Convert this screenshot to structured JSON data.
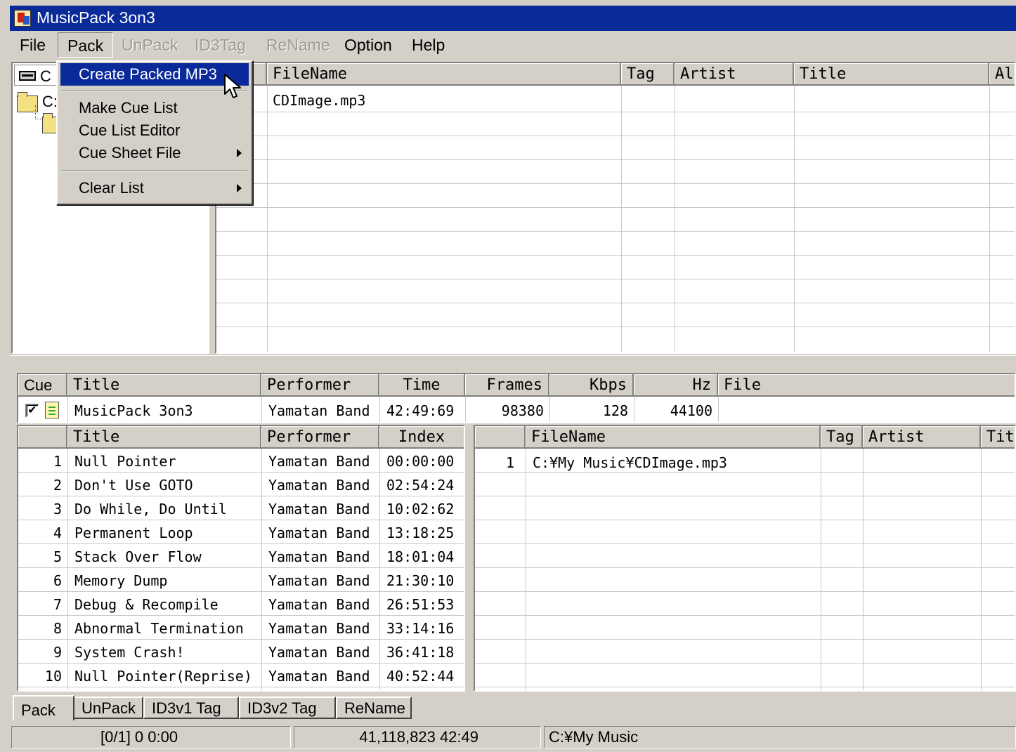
{
  "window": {
    "title": "MusicPack 3on3"
  },
  "menubar": [
    {
      "label": "File",
      "enabled": true
    },
    {
      "label": "Pack",
      "enabled": true
    },
    {
      "label": "UnPack",
      "enabled": false
    },
    {
      "label": "ID3Tag",
      "enabled": false
    },
    {
      "label": "ReName",
      "enabled": false
    },
    {
      "label": "Option",
      "enabled": true
    },
    {
      "label": "Help",
      "enabled": true
    }
  ],
  "pack_menu": {
    "items": [
      {
        "label": "Create Packed MP3",
        "selected": true
      },
      {
        "label": "Make Cue List"
      },
      {
        "label": "Cue List Editor"
      },
      {
        "label": "Cue Sheet File",
        "submenu": true
      },
      {
        "label": "Clear List",
        "submenu": true
      }
    ]
  },
  "tree": {
    "drive": "C",
    "root": "C:"
  },
  "file_list": {
    "headers": [
      "FileName",
      "Tag",
      "Artist",
      "Title",
      "Alb"
    ],
    "rows": [
      {
        "filename": "CDImage.mp3"
      }
    ]
  },
  "cue_summary": {
    "headers": [
      "Cue",
      "Title",
      "Performer",
      "Time",
      "Frames",
      "Kbps",
      "Hz",
      "File"
    ],
    "row": {
      "checked": true,
      "title": "MusicPack 3on3",
      "performer": "Yamatan Band",
      "time": "42:49:69",
      "frames": "98380",
      "kbps": "128",
      "hz": "44100",
      "file": ""
    }
  },
  "tracks": {
    "headers": [
      "",
      "Title",
      "Performer",
      "Index"
    ],
    "rows": [
      {
        "no": "1",
        "title": "Null Pointer",
        "performer": "Yamatan Band",
        "index": "00:00:00"
      },
      {
        "no": "2",
        "title": "Don't Use GOTO",
        "performer": "Yamatan Band",
        "index": "02:54:24"
      },
      {
        "no": "3",
        "title": "Do While, Do Until",
        "performer": "Yamatan Band",
        "index": "10:02:62"
      },
      {
        "no": "4",
        "title": "Permanent Loop",
        "performer": "Yamatan Band",
        "index": "13:18:25"
      },
      {
        "no": "5",
        "title": "Stack Over Flow",
        "performer": "Yamatan Band",
        "index": "18:01:04"
      },
      {
        "no": "6",
        "title": "Memory Dump",
        "performer": "Yamatan Band",
        "index": "21:30:10"
      },
      {
        "no": "7",
        "title": "Debug & Recompile",
        "performer": "Yamatan Band",
        "index": "26:51:53"
      },
      {
        "no": "8",
        "title": "Abnormal Termination",
        "performer": "Yamatan Band",
        "index": "33:14:16"
      },
      {
        "no": "9",
        "title": "System Crash!",
        "performer": "Yamatan Band",
        "index": "36:41:18"
      },
      {
        "no": "10",
        "title": "Null Pointer(Reprise)",
        "performer": "Yamatan Band",
        "index": "40:52:44"
      }
    ]
  },
  "source_files": {
    "headers": [
      "",
      "FileName",
      "Tag",
      "Artist",
      "Tit"
    ],
    "rows": [
      {
        "no": "1",
        "filename": "C:¥My Music¥CDImage.mp3"
      }
    ]
  },
  "tabs": [
    {
      "label": "Pack",
      "active": true
    },
    {
      "label": "UnPack"
    },
    {
      "label": "ID3v1 Tag"
    },
    {
      "label": "ID3v2 Tag"
    },
    {
      "label": "ReName"
    }
  ],
  "status": {
    "count": "[0/1]  0  0:00",
    "size": "41,118,823  42:49",
    "path": "C:¥My Music"
  }
}
